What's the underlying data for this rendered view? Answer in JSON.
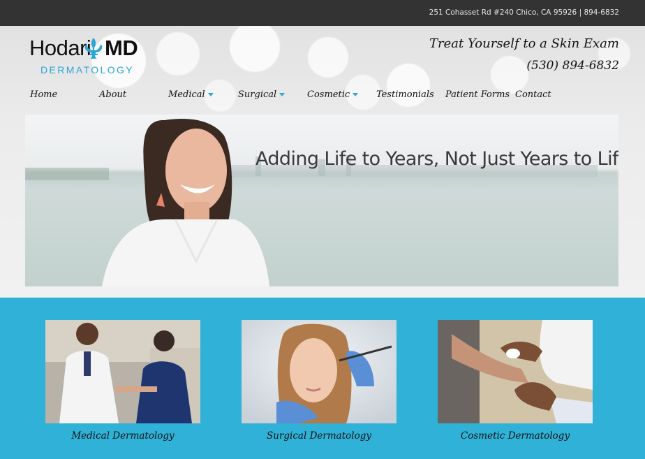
{
  "topbar": {
    "address": "251 Cohasset Rd #240   Chico, CA 95926 | 894-6832"
  },
  "logo": {
    "name": "Hodari",
    "md": "MD",
    "subtitle": "DERMATOLOGY",
    "icon": "fleur-de-lis-icon"
  },
  "tagline": {
    "line1": "Treat Yourself to a Skin Exam",
    "phone": "(530) 894-6832"
  },
  "nav": {
    "items": [
      {
        "label": "Home",
        "dropdown": false
      },
      {
        "label": "About",
        "dropdown": false
      },
      {
        "label": "Medical",
        "dropdown": true
      },
      {
        "label": "Surgical",
        "dropdown": true
      },
      {
        "label": "Cosmetic",
        "dropdown": true
      },
      {
        "label": "Testimonials",
        "dropdown": false
      },
      {
        "label": "Patient Forms",
        "dropdown": false
      },
      {
        "label": "Contact",
        "dropdown": false
      }
    ]
  },
  "hero": {
    "headline": "Adding Life to Years, Not Just Years to Life"
  },
  "features": {
    "cards": [
      {
        "label": "Medical Dermatology"
      },
      {
        "label": "Surgical Dermatology"
      },
      {
        "label": "Cosmetic Dermatology"
      }
    ]
  },
  "colors": {
    "accent": "#2aa7d6",
    "topbar": "#333333",
    "features_bg": "#30b1d7"
  }
}
